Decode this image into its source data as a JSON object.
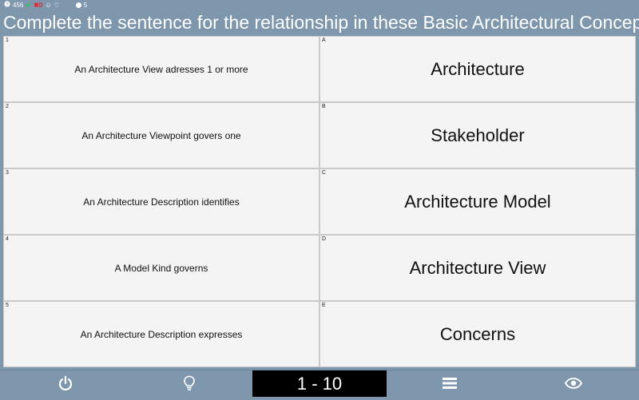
{
  "status": {
    "questions_count": "456",
    "correct_count": "",
    "wrong_count": "0",
    "lives_count": "5"
  },
  "title": "Complete the sentence for the relationship in these Basic Architectural Concepts",
  "left_items": [
    {
      "index": "1",
      "text": "An Architecture View adresses 1 or more"
    },
    {
      "index": "2",
      "text": "An Architecture Viewpoint govers one"
    },
    {
      "index": "3",
      "text": "An Architecture Description identifies"
    },
    {
      "index": "4",
      "text": "A Model Kind governs"
    },
    {
      "index": "5",
      "text": "An Architecture Description expresses"
    }
  ],
  "right_items": [
    {
      "index": "A",
      "text": "Architecture"
    },
    {
      "index": "B",
      "text": "Stakeholder"
    },
    {
      "index": "C",
      "text": "Architecture Model"
    },
    {
      "index": "D",
      "text": "Architecture View"
    },
    {
      "index": "E",
      "text": "Concerns"
    }
  ],
  "toolbar": {
    "counter": "1 - 10",
    "icons": [
      "power-icon",
      "lightbulb-icon",
      "menu-icon",
      "eye-icon"
    ]
  },
  "colors": {
    "background": "#7f97ad",
    "cell": "#f4f4f4",
    "counter_bg": "#000000"
  }
}
